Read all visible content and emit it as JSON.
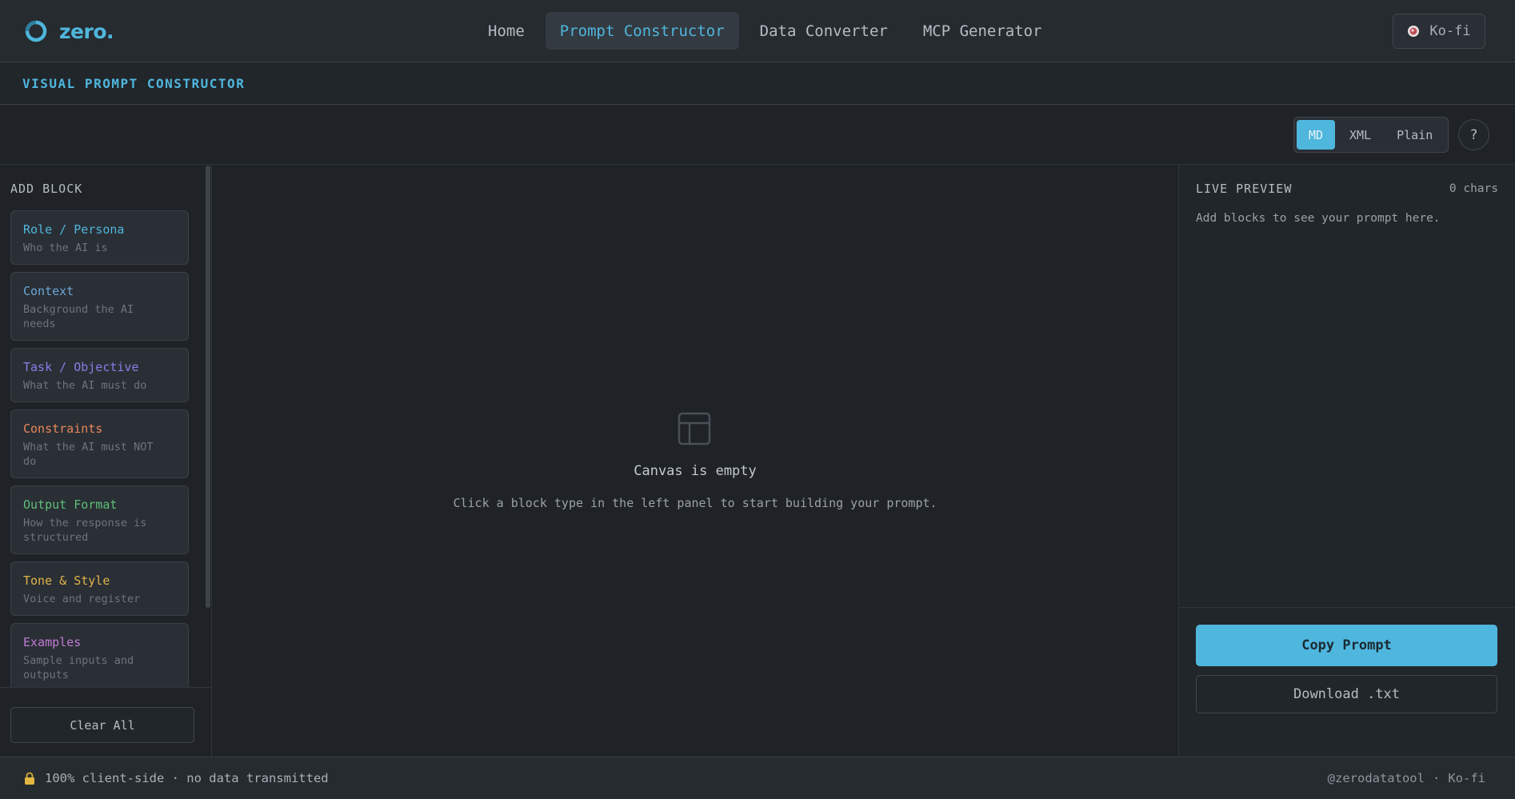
{
  "app": {
    "logo_text": "zero.",
    "nav": [
      {
        "label": "Home",
        "active": false
      },
      {
        "label": "Prompt Constructor",
        "active": true
      },
      {
        "label": "Data Converter",
        "active": false
      },
      {
        "label": "MCP Generator",
        "active": false
      }
    ],
    "kofi_label": "Ko-fi"
  },
  "page": {
    "title": "VISUAL PROMPT CONSTRUCTOR"
  },
  "toolbar": {
    "formats": [
      {
        "label": "MD",
        "active": true
      },
      {
        "label": "XML",
        "active": false
      },
      {
        "label": "Plain",
        "active": false
      }
    ],
    "help_label": "?"
  },
  "left_panel": {
    "title": "ADD BLOCK",
    "blocks": [
      {
        "title": "Role / Persona",
        "desc": "Who the AI is",
        "color": "#4fb6dd"
      },
      {
        "title": "Context",
        "desc": "Background the AI needs",
        "color": "#6aa6d8"
      },
      {
        "title": "Task / Objective",
        "desc": "What the AI must do",
        "color": "#8a7be8"
      },
      {
        "title": "Constraints",
        "desc": "What the AI must NOT do",
        "color": "#e8875a"
      },
      {
        "title": "Output Format",
        "desc": "How the response is structured",
        "color": "#5fbf7a"
      },
      {
        "title": "Tone & Style",
        "desc": "Voice and register",
        "color": "#e0b34a"
      },
      {
        "title": "Examples",
        "desc": "Sample inputs and outputs",
        "color": "#c17ad6"
      }
    ],
    "clear_label": "Clear All"
  },
  "canvas": {
    "empty_title": "Canvas is empty",
    "empty_subtitle": "Click a block type in the left panel to start building your prompt.",
    "icon": "layout-icon"
  },
  "preview": {
    "title": "LIVE PREVIEW",
    "char_count": "0 chars",
    "placeholder": "Add blocks to see your prompt here.",
    "copy_label": "Copy Prompt",
    "download_label": "Download .txt"
  },
  "footer": {
    "privacy_text": "100% client-side · no data transmitted",
    "handle": "@zerodatatool",
    "separator": "·",
    "kofi_label": "Ko-fi"
  },
  "colors": {
    "accent": "#4fb6dd",
    "background": "#1f2327"
  }
}
